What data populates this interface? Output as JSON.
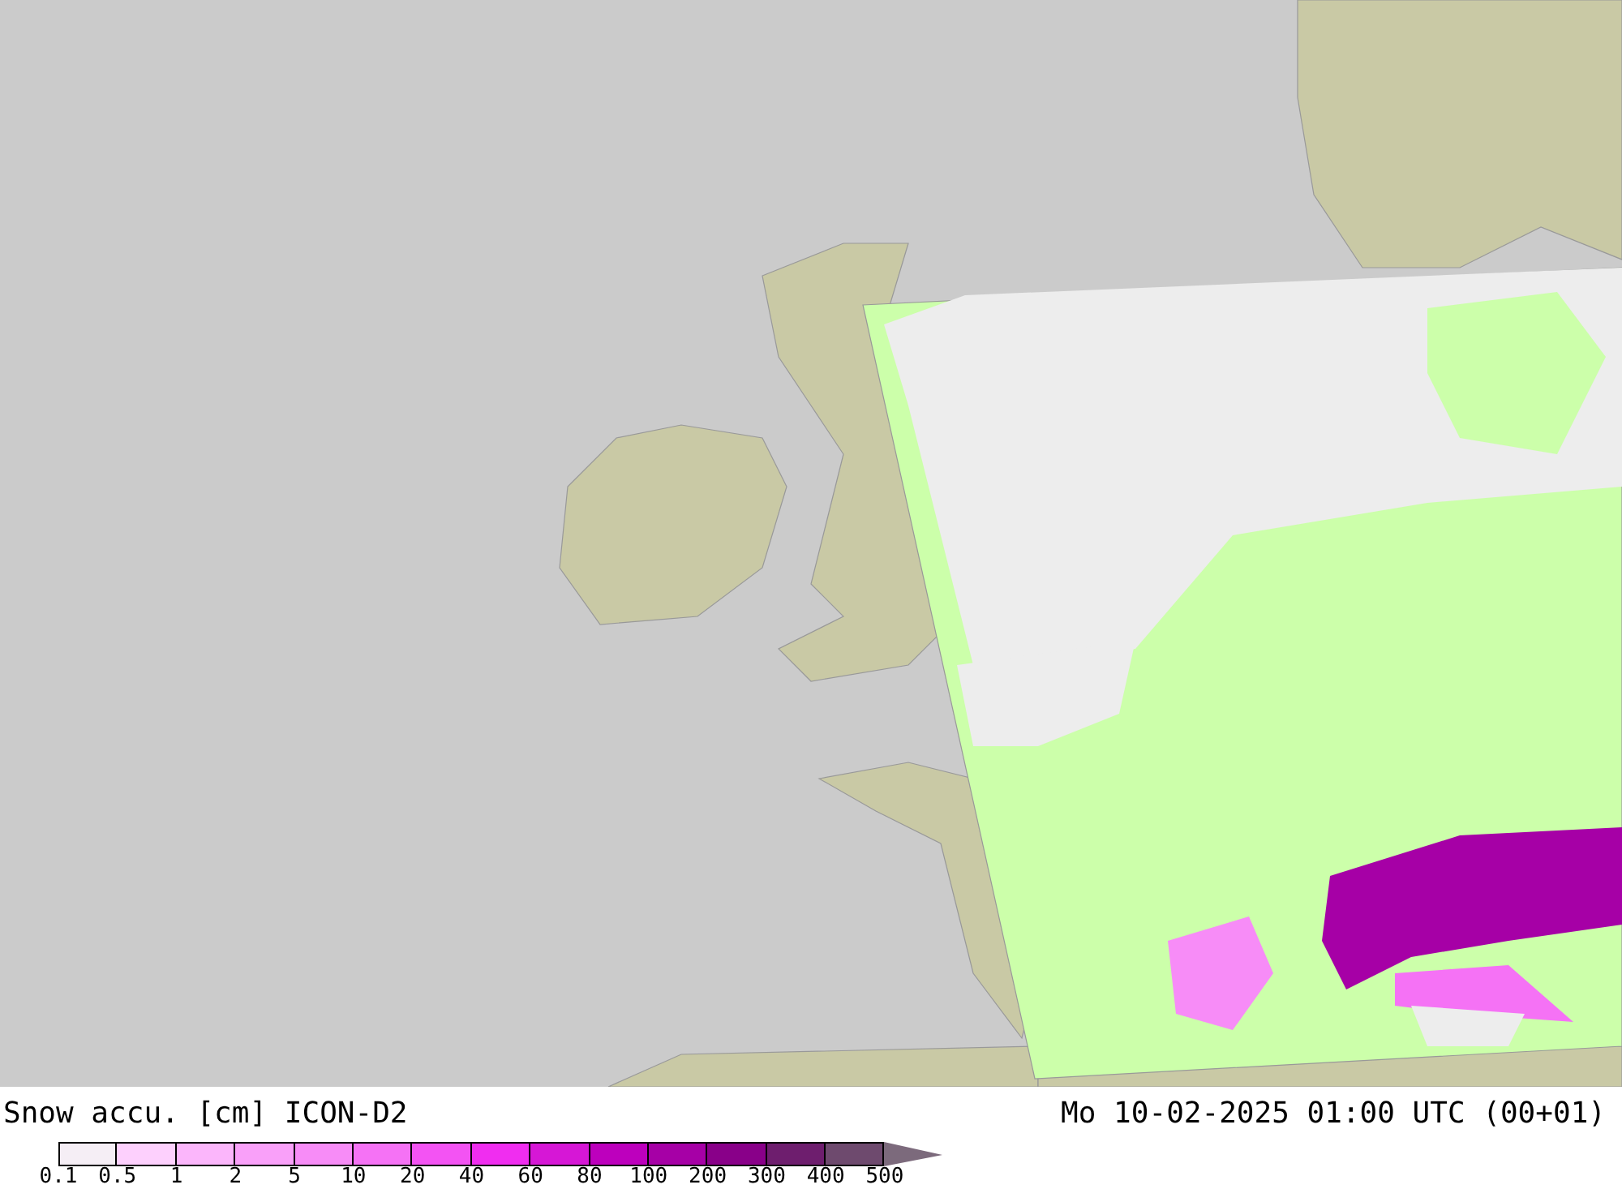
{
  "title": "Snow accu. [cm] ICON-D2",
  "valid_time": "Mo 10-02-2025 01:00 UTC (00+01)",
  "legend": {
    "bins": [
      {
        "color": "#f5eef5"
      },
      {
        "color": "#fdd0fd"
      },
      {
        "color": "#fbb6fb"
      },
      {
        "color": "#f9a0f9"
      },
      {
        "color": "#f78cf7"
      },
      {
        "color": "#f572f5"
      },
      {
        "color": "#f353f3"
      },
      {
        "color": "#f02df0"
      },
      {
        "color": "#d617d6"
      },
      {
        "color": "#bd00bd"
      },
      {
        "color": "#a600a6"
      },
      {
        "color": "#890089"
      },
      {
        "color": "#6e1e6e"
      },
      {
        "color": "#6e4a6e"
      }
    ],
    "ticks": [
      "0.1",
      "0.5",
      "1",
      "2",
      "5",
      "10",
      "20",
      "40",
      "60",
      "80",
      "100",
      "200",
      "300",
      "400",
      "500"
    ]
  }
}
